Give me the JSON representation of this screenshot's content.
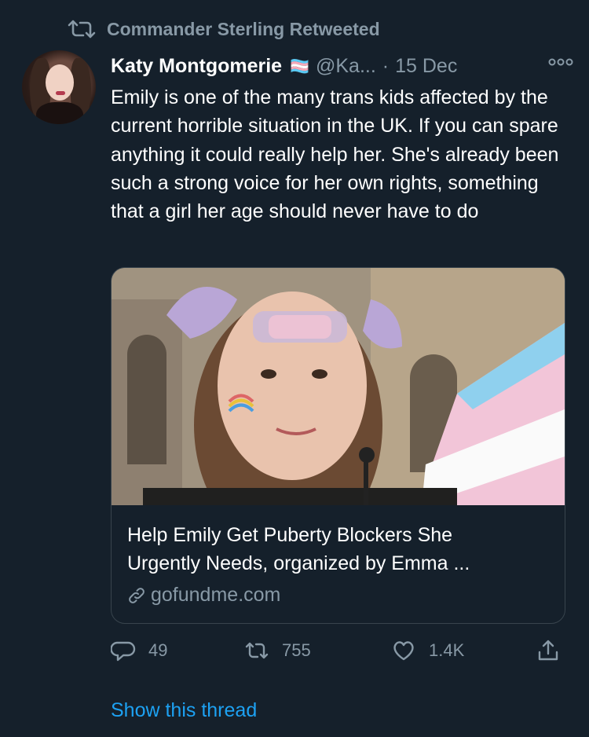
{
  "retweet_label": "Commander Sterling Retweeted",
  "tweet": {
    "author_name": "Katy Montgomerie",
    "author_emoji": "🏳️‍⚧️",
    "handle": "@Ka...",
    "separator": "·",
    "date": "15 Dec",
    "text": "Emily is one of the many trans kids affected by the current horrible situation in the UK. If you can spare anything it could really help her. She's already been such a strong voice for her own rights, something that a girl her age should never have to do"
  },
  "card": {
    "title_line1": "Help Emily Get Puberty Blockers She",
    "title_line2": "Urgently Needs, organized by Emma ...",
    "domain": "gofundme.com"
  },
  "actions": {
    "replies": "49",
    "retweets": "755",
    "likes": "1.4K"
  },
  "show_thread": "Show this thread",
  "colors": {
    "background": "#15202b",
    "muted": "#8899a6",
    "link": "#1da1f2",
    "border": "#38444d"
  },
  "icons": [
    "retweet-icon",
    "more-icon",
    "link-icon",
    "reply-icon",
    "like-icon",
    "share-icon"
  ]
}
